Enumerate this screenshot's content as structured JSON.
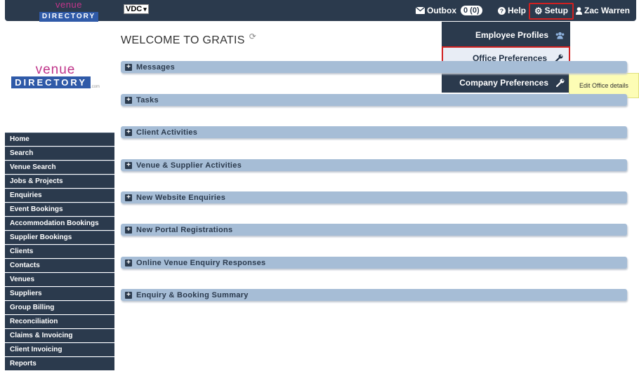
{
  "topbar": {
    "logo_line1": "venue",
    "logo_line2": "DIRECTORY",
    "office_select": "VDC",
    "outbox_label": "Outbox",
    "outbox_count": "0 (0)",
    "help_label": "Help",
    "setup_label": "Setup",
    "user_label": "Zac Warren"
  },
  "setup_menu": {
    "items": [
      {
        "label": "Employee Profiles",
        "icon": "users-icon"
      },
      {
        "label": "Office Preferences",
        "icon": "wrench-icon"
      },
      {
        "label": "Company Preferences",
        "icon": "wrench-icon"
      }
    ],
    "tooltip": "Edit Office details"
  },
  "sidebar": {
    "logo_line1": "venue",
    "logo_line2": "DIRECTORY",
    "logo_suffix": ".com",
    "items": [
      "Home",
      "Search",
      "Venue Search",
      "Jobs & Projects",
      "Enquiries",
      "Event Bookings",
      "Accommodation Bookings",
      "Supplier Bookings",
      "Clients",
      "Contacts",
      "Venues",
      "Suppliers",
      "Group Billing",
      "Reconciliation",
      "Claims & Invoicing",
      "Client Invoicing",
      "Reports"
    ]
  },
  "main": {
    "title": "WELCOME TO GRATIS",
    "panels": [
      "Messages",
      "Tasks",
      "Client Activities",
      "Venue & Supplier Activities",
      "New Website Enquiries",
      "New Portal Registrations",
      "Online Venue Enquiry Responses",
      "Enquiry & Booking Summary"
    ]
  },
  "colors": {
    "navbar": "#2b3a4d",
    "panel": "#a6bdd6",
    "highlight": "#d02020",
    "tooltip": "#fdfdb5",
    "brand_pink": "#c0358a",
    "brand_blue": "#2f5aa8"
  }
}
